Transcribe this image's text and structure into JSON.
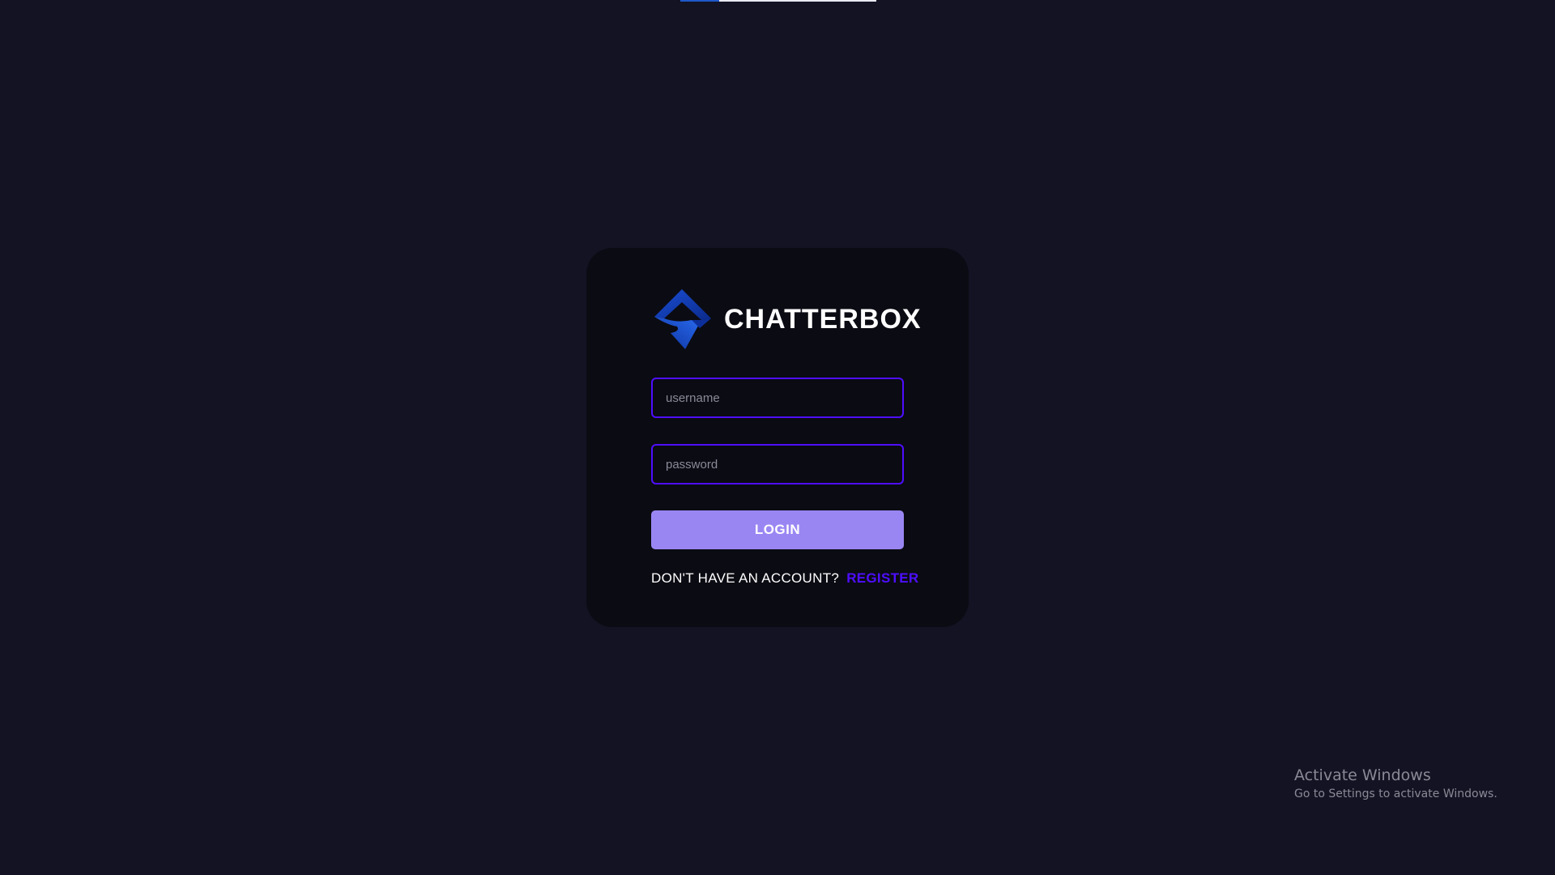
{
  "page_load_progress": 0.2,
  "colors": {
    "background": "#131324",
    "card": "#0b0b13",
    "accent": "#4e0eff",
    "button": "#9a86f3"
  },
  "brand": {
    "logo_icon": "chatterbox-logo-icon",
    "name": "CHATTERBOX"
  },
  "form": {
    "username_placeholder": "username",
    "username_value": "",
    "password_placeholder": "password",
    "password_value": "",
    "login_label": "LOGIN",
    "register_prompt": "DON'T HAVE AN ACCOUNT?",
    "register_link": "REGISTER"
  },
  "watermark": {
    "title": "Activate Windows",
    "subtitle": "Go to Settings to activate Windows."
  }
}
